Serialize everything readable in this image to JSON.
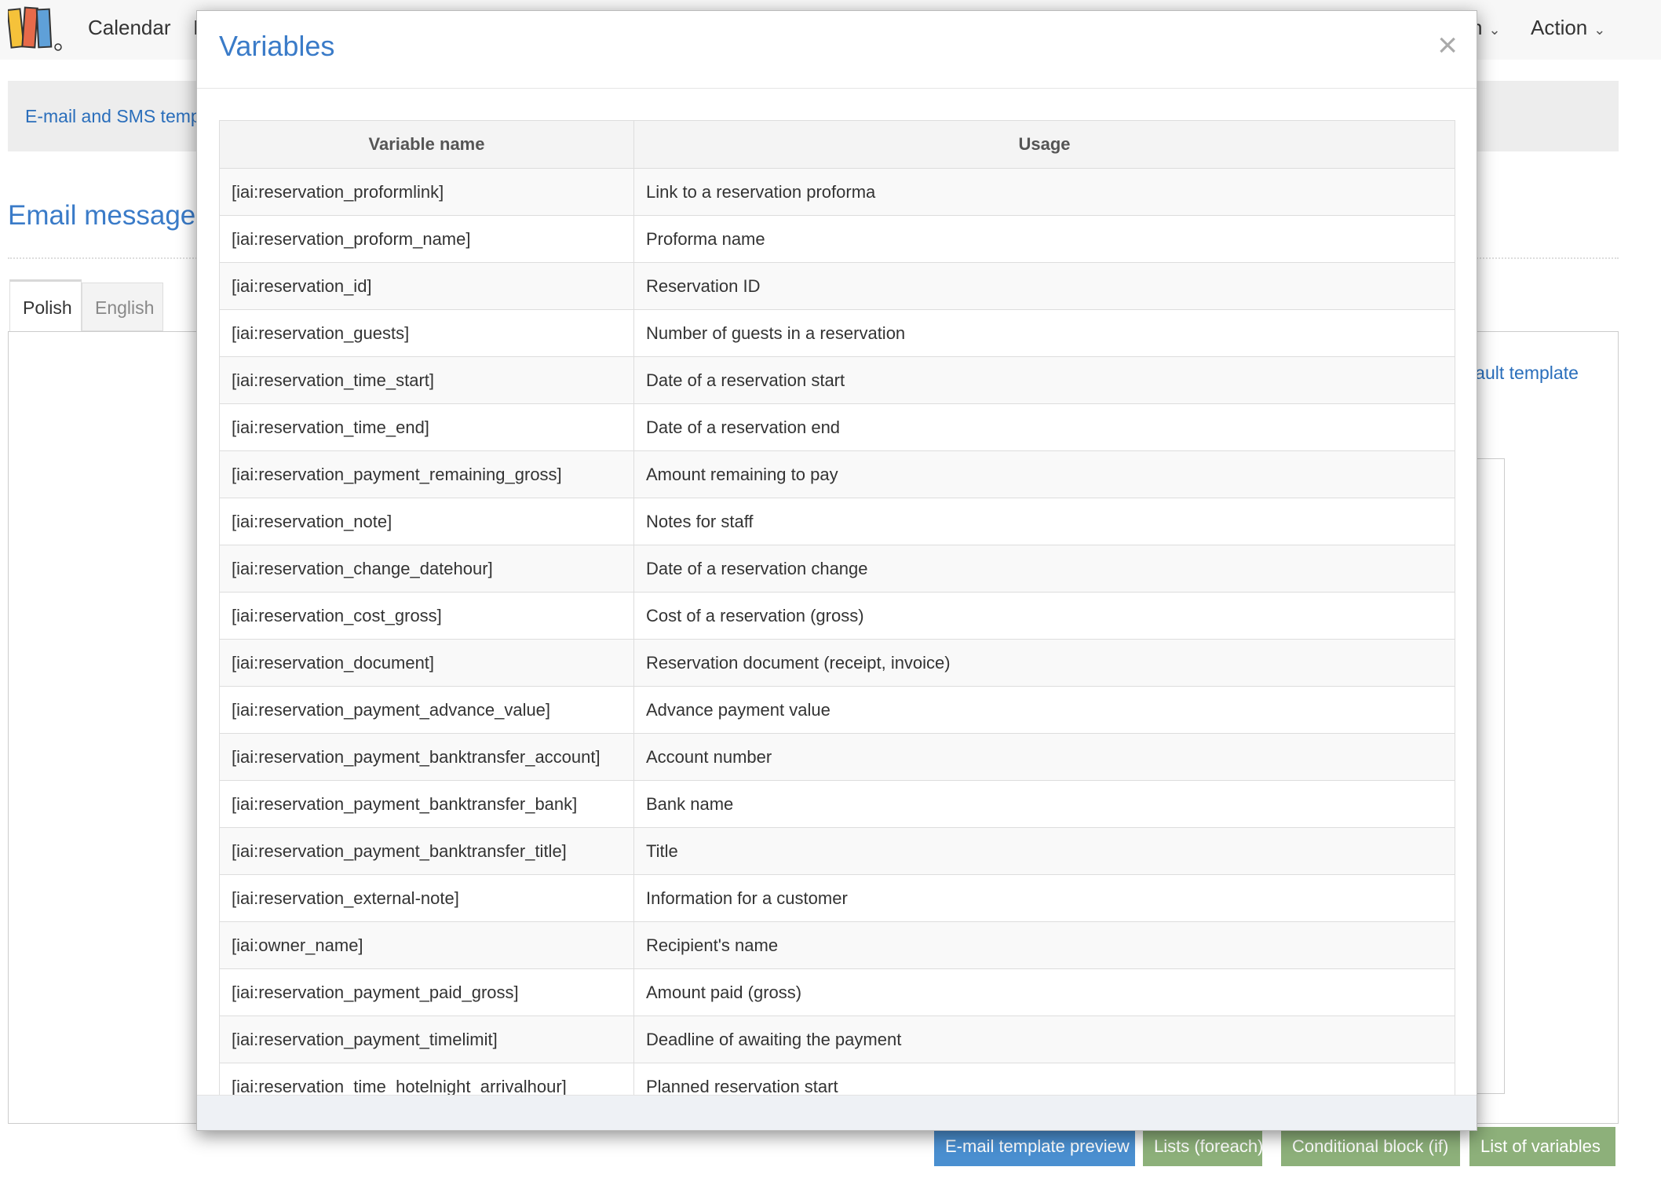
{
  "nav": {
    "calendar": "Calendar",
    "partial_left": "I",
    "partial_right": "n",
    "action": "Action",
    "chevron": "⌄"
  },
  "breadcrumb": "E-mail and SMS templ",
  "section_title": "Email message s",
  "tabs": {
    "polish": "Polish",
    "english": "English"
  },
  "default_template_link": "efault template",
  "stray_char": "]",
  "buttons": {
    "preview": "E-mail template preview",
    "foreach": "Lists (foreach)",
    "conditional": "Conditional block (if)",
    "variables": "List of variables"
  },
  "modal": {
    "title": "Variables",
    "close": "×",
    "headers": {
      "name": "Variable name",
      "usage": "Usage"
    },
    "rows": [
      {
        "name": "[iai:reservation_proformlink]",
        "usage": "Link to a reservation proforma"
      },
      {
        "name": "[iai:reservation_proform_name]",
        "usage": "Proforma name"
      },
      {
        "name": "[iai:reservation_id]",
        "usage": "Reservation ID"
      },
      {
        "name": "[iai:reservation_guests]",
        "usage": "Number of guests in a reservation"
      },
      {
        "name": "[iai:reservation_time_start]",
        "usage": "Date of a reservation start"
      },
      {
        "name": "[iai:reservation_time_end]",
        "usage": "Date of a reservation end"
      },
      {
        "name": "[iai:reservation_payment_remaining_gross]",
        "usage": "Amount remaining to pay"
      },
      {
        "name": "[iai:reservation_note]",
        "usage": "Notes for staff"
      },
      {
        "name": "[iai:reservation_change_datehour]",
        "usage": "Date of a reservation change"
      },
      {
        "name": "[iai:reservation_cost_gross]",
        "usage": "Cost of a reservation (gross)"
      },
      {
        "name": "[iai:reservation_document]",
        "usage": "Reservation document (receipt, invoice)"
      },
      {
        "name": "[iai:reservation_payment_advance_value]",
        "usage": "Advance payment value"
      },
      {
        "name": "[iai:reservation_payment_banktransfer_account]",
        "usage": "Account number"
      },
      {
        "name": "[iai:reservation_payment_banktransfer_bank]",
        "usage": "Bank name"
      },
      {
        "name": "[iai:reservation_payment_banktransfer_title]",
        "usage": "Title"
      },
      {
        "name": "[iai:reservation_external-note]",
        "usage": "Information for a customer"
      },
      {
        "name": "[iai:owner_name]",
        "usage": "Recipient's name"
      },
      {
        "name": "[iai:reservation_payment_paid_gross]",
        "usage": "Amount paid (gross)"
      },
      {
        "name": "[iai:reservation_payment_timelimit]",
        "usage": "Deadline of awaiting the payment"
      },
      {
        "name": "[iai:reservation_time_hotelnight_arrivalhour]",
        "usage": "Planned reservation start"
      }
    ]
  }
}
